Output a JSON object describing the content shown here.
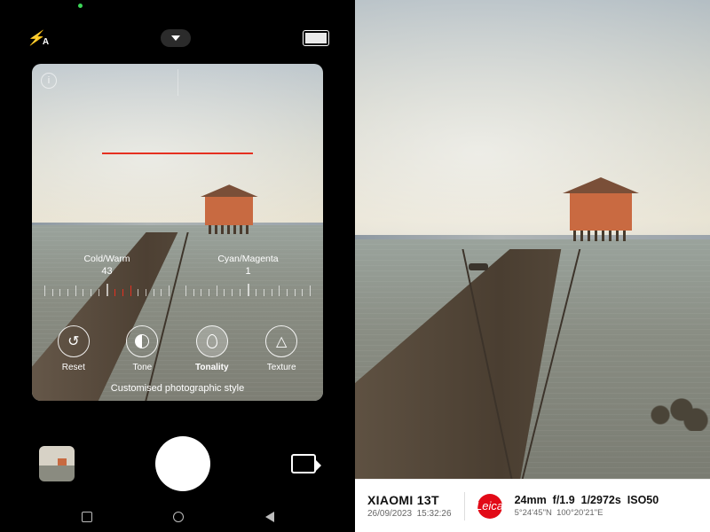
{
  "status": {
    "recording_indicator": true
  },
  "topbar": {
    "flash_mode": "auto",
    "flash_glyph": "⚡",
    "flash_sub": "A"
  },
  "viewfinder": {
    "info_glyph": "i",
    "sliders": [
      {
        "label": "Cold/Warm",
        "value": "43"
      },
      {
        "label": "Cyan/Magenta",
        "value": "1"
      }
    ],
    "tools": [
      {
        "id": "reset",
        "label": "Reset",
        "active": false
      },
      {
        "id": "tone",
        "label": "Tone",
        "active": false
      },
      {
        "id": "tonality",
        "label": "Tonality",
        "active": true
      },
      {
        "id": "texture",
        "label": "Texture",
        "active": false
      }
    ],
    "caption": "Customised photographic style"
  },
  "bottom": {
    "thumbnail_desc": "last-photo-thumbnail",
    "mode": "video-mode-toggle"
  },
  "result": {
    "device": "XIAOMI 13T",
    "date": "26/09/2023",
    "time": "15:32:26",
    "brand_mark": "Leica",
    "focal_length": "24mm",
    "aperture": "f/1.9",
    "shutter": "1/2972s",
    "iso": "ISO50",
    "gps_lat": "5°24'45\"N",
    "gps_lon": "100°20'21\"E"
  }
}
